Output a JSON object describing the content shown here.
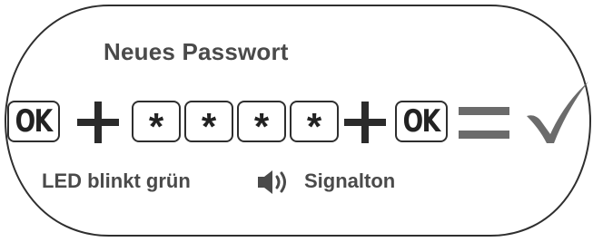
{
  "title": "Neues Passwort",
  "sequence": {
    "ok_label": "OK",
    "star_label": "*"
  },
  "status": {
    "led_text": "LED blinkt grün",
    "sound_text": "Signalton"
  },
  "icons": {
    "plus": "plus-icon",
    "equals": "equals-icon",
    "check": "checkmark-icon",
    "speaker": "speaker-icon"
  },
  "colors": {
    "outline": "#2f2f2f",
    "text": "#4a4a4a",
    "key_border": "#2e2e2e",
    "equals": "#6b6b6b",
    "check": "#6b6b6b"
  }
}
